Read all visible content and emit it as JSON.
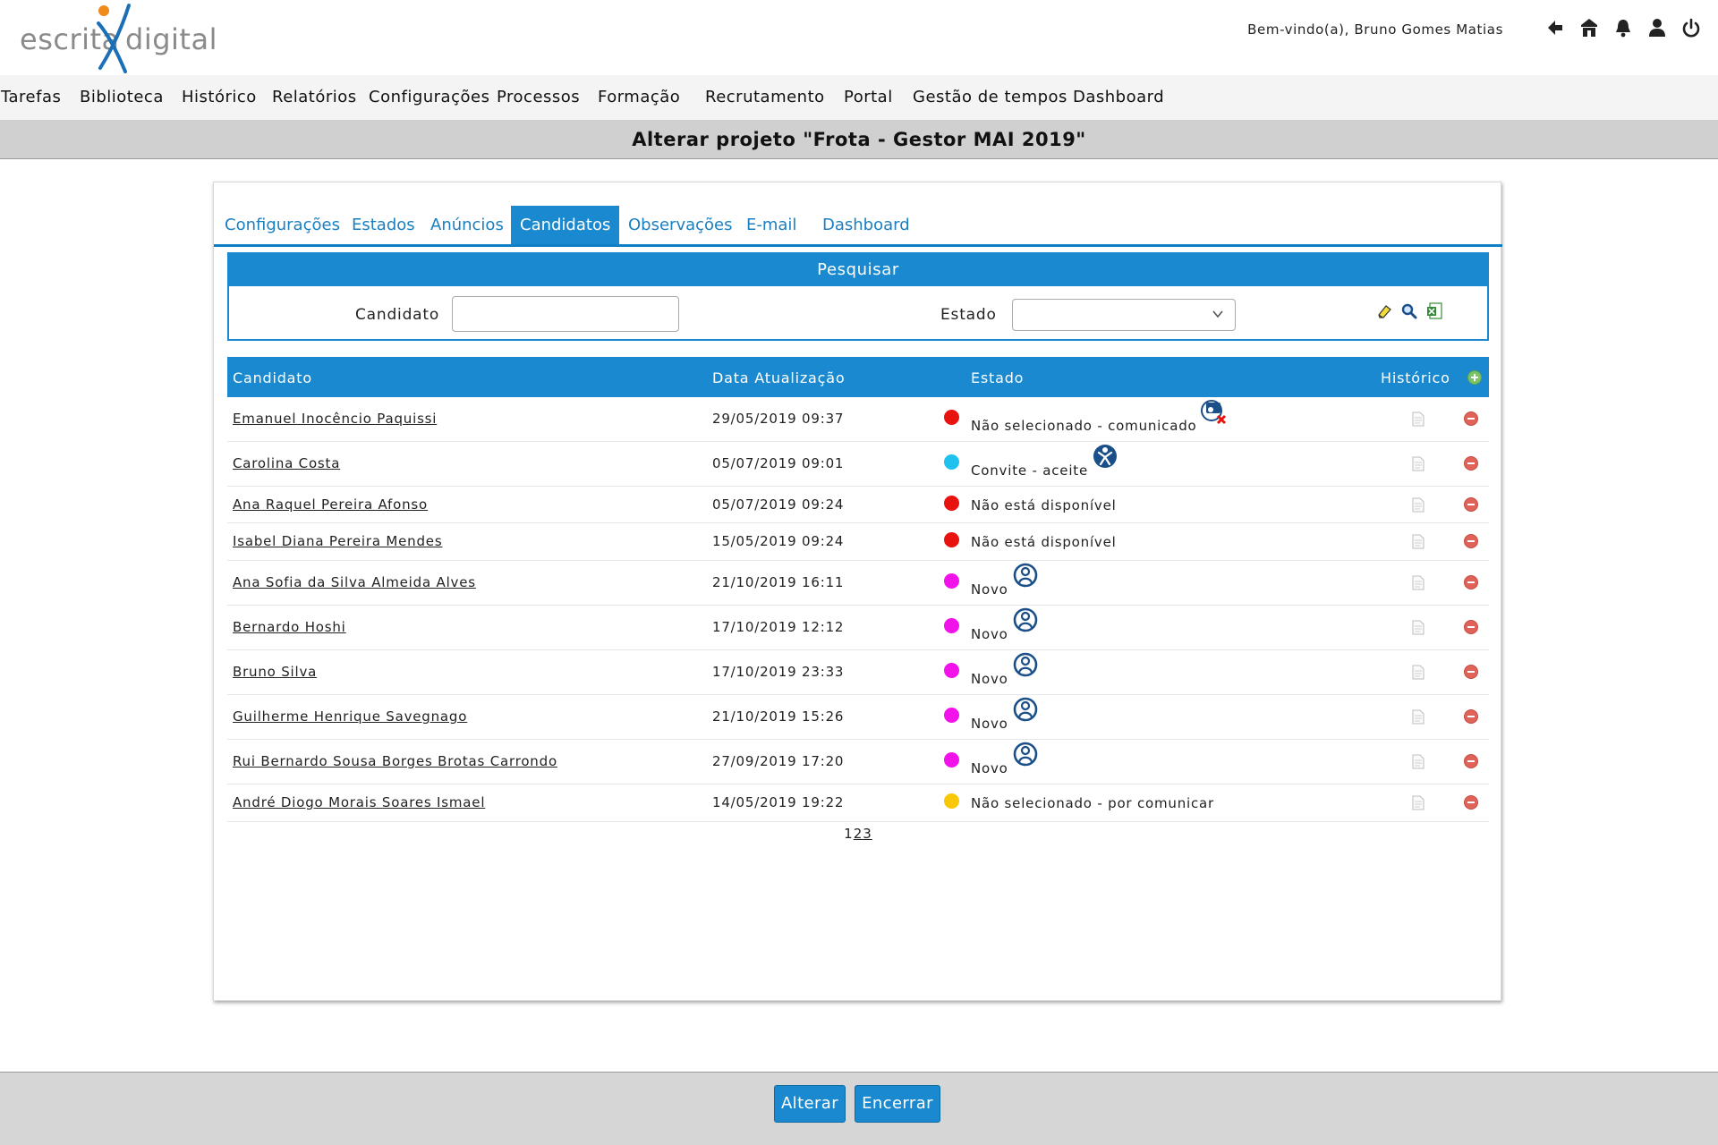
{
  "logo": {
    "left": "escrita",
    "right": "digital"
  },
  "header": {
    "welcome": "Bem-vindo(a), Bruno Gomes Matias",
    "icons": [
      "back-arrow-icon",
      "home-icon",
      "bell-icon",
      "user-icon",
      "power-icon"
    ]
  },
  "nav": [
    "Tarefas",
    "Biblioteca",
    "Histórico",
    "Relatórios",
    "Configurações",
    "Processos",
    "Formação",
    "Recrutamento",
    "Portal",
    "Gestão de tempos",
    "Dashboard"
  ],
  "page_title": "Alterar projeto \"Frota - Gestor MAI 2019\"",
  "tabs": [
    "Configurações",
    "Estados",
    "Anúncios",
    "Candidatos",
    "Observações",
    "E-mail",
    "Dashboard"
  ],
  "active_tab": "Candidatos",
  "search": {
    "title": "Pesquisar",
    "candidate_label": "Candidato",
    "candidate_value": "",
    "state_label": "Estado",
    "state_value": ""
  },
  "table": {
    "headers": {
      "candidate": "Candidato",
      "updated": "Data Atualização",
      "state": "Estado",
      "history": "Histórico"
    },
    "rows": [
      {
        "name": "Emanuel Inocêncio Paquissi",
        "date": "29/05/2019 09:37",
        "state": "Não selecionado - comunicado",
        "dot": "#e8120f",
        "icon": "notification-rejected-icon"
      },
      {
        "name": "Carolina Costa",
        "date": "05/07/2019 09:01",
        "state": "Convite - aceite",
        "dot": "#1fc2ee",
        "icon": "invite-accepted-icon"
      },
      {
        "name": "Ana Raquel Pereira Afonso",
        "date": "05/07/2019 09:24",
        "state": "Não está disponível",
        "dot": "#e8120f",
        "icon": ""
      },
      {
        "name": "Isabel Diana Pereira Mendes",
        "date": "15/05/2019 09:24",
        "state": "Não está disponível",
        "dot": "#e8120f",
        "icon": ""
      },
      {
        "name": "Ana Sofia da Silva Almeida Alves",
        "date": "21/10/2019 16:11",
        "state": "Novo",
        "dot": "#f212ea",
        "icon": "new-candidate-icon"
      },
      {
        "name": "Bernardo Hoshi",
        "date": "17/10/2019 12:12",
        "state": "Novo",
        "dot": "#f212ea",
        "icon": "new-candidate-icon"
      },
      {
        "name": "Bruno Silva",
        "date": "17/10/2019 23:33",
        "state": "Novo",
        "dot": "#f212ea",
        "icon": "new-candidate-icon"
      },
      {
        "name": "Guilherme Henrique Savegnago",
        "date": "21/10/2019 15:26",
        "state": "Novo",
        "dot": "#f212ea",
        "icon": "new-candidate-icon"
      },
      {
        "name": "Rui Bernardo Sousa Borges Brotas Carrondo",
        "date": "27/09/2019 17:20",
        "state": "Novo",
        "dot": "#f212ea",
        "icon": "new-candidate-icon"
      },
      {
        "name": "André Diogo Morais Soares Ismael",
        "date": "14/05/2019 19:22",
        "state": "Não selecionado - por comunicar",
        "dot": "#f7c708",
        "icon": ""
      }
    ]
  },
  "pagination": [
    "1",
    "2",
    "3"
  ],
  "buttons": {
    "save": "Alterar",
    "close": "Encerrar"
  },
  "colors": {
    "accent": "#1a89cf",
    "logo_orange": "#f08a1c",
    "logo_blue": "#1a6fb6"
  }
}
